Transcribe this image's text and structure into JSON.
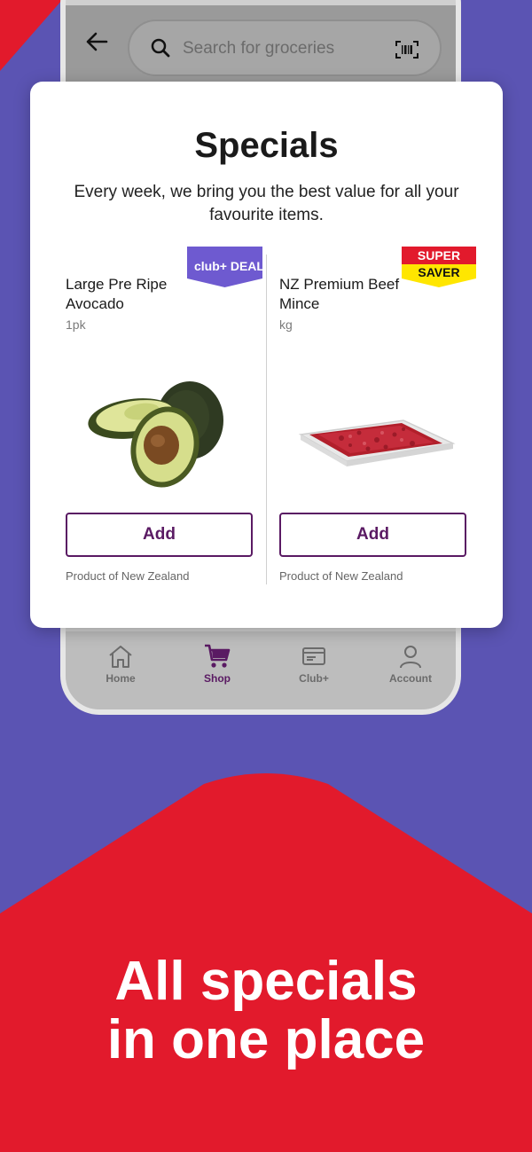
{
  "search": {
    "placeholder": "Search for groceries"
  },
  "card": {
    "title": "Specials",
    "subtitle": "Every week, we bring you the best value for all your favourite items."
  },
  "products": [
    {
      "name": "Large Pre Ripe Avocado",
      "unit": "1pk",
      "add_label": "Add",
      "origin": "Product of New Zealand",
      "badge": "club+ DEAL"
    },
    {
      "name": "NZ Premium Beef Mince",
      "unit": "kg",
      "add_label": "Add",
      "origin": "Product of New Zealand",
      "badge_top": "SUPER",
      "badge_bottom": "SAVER"
    }
  ],
  "nav": [
    {
      "label": "Home",
      "icon": "home-icon"
    },
    {
      "label": "Shop",
      "icon": "cart-icon"
    },
    {
      "label": "Club+",
      "icon": "card-icon"
    },
    {
      "label": "Account",
      "icon": "person-icon"
    }
  ],
  "headline": {
    "line1": "All specials",
    "line2": "in one place"
  },
  "colors": {
    "purple_bg": "#5b54b3",
    "brand_red": "#e21a2c",
    "accent_purple": "#5a1a63",
    "saver_yellow": "#ffe600"
  }
}
